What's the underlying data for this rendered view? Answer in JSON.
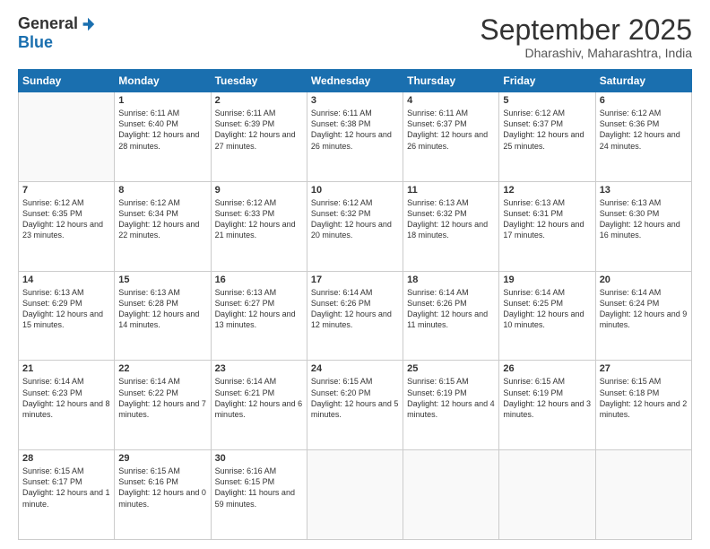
{
  "logo": {
    "general": "General",
    "blue": "Blue"
  },
  "title": "September 2025",
  "location": "Dharashiv, Maharashtra, India",
  "headers": [
    "Sunday",
    "Monday",
    "Tuesday",
    "Wednesday",
    "Thursday",
    "Friday",
    "Saturday"
  ],
  "weeks": [
    [
      {
        "day": "",
        "info": ""
      },
      {
        "day": "1",
        "info": "Sunrise: 6:11 AM\nSunset: 6:40 PM\nDaylight: 12 hours\nand 28 minutes."
      },
      {
        "day": "2",
        "info": "Sunrise: 6:11 AM\nSunset: 6:39 PM\nDaylight: 12 hours\nand 27 minutes."
      },
      {
        "day": "3",
        "info": "Sunrise: 6:11 AM\nSunset: 6:38 PM\nDaylight: 12 hours\nand 26 minutes."
      },
      {
        "day": "4",
        "info": "Sunrise: 6:11 AM\nSunset: 6:37 PM\nDaylight: 12 hours\nand 26 minutes."
      },
      {
        "day": "5",
        "info": "Sunrise: 6:12 AM\nSunset: 6:37 PM\nDaylight: 12 hours\nand 25 minutes."
      },
      {
        "day": "6",
        "info": "Sunrise: 6:12 AM\nSunset: 6:36 PM\nDaylight: 12 hours\nand 24 minutes."
      }
    ],
    [
      {
        "day": "7",
        "info": "Sunrise: 6:12 AM\nSunset: 6:35 PM\nDaylight: 12 hours\nand 23 minutes."
      },
      {
        "day": "8",
        "info": "Sunrise: 6:12 AM\nSunset: 6:34 PM\nDaylight: 12 hours\nand 22 minutes."
      },
      {
        "day": "9",
        "info": "Sunrise: 6:12 AM\nSunset: 6:33 PM\nDaylight: 12 hours\nand 21 minutes."
      },
      {
        "day": "10",
        "info": "Sunrise: 6:12 AM\nSunset: 6:32 PM\nDaylight: 12 hours\nand 20 minutes."
      },
      {
        "day": "11",
        "info": "Sunrise: 6:13 AM\nSunset: 6:32 PM\nDaylight: 12 hours\nand 18 minutes."
      },
      {
        "day": "12",
        "info": "Sunrise: 6:13 AM\nSunset: 6:31 PM\nDaylight: 12 hours\nand 17 minutes."
      },
      {
        "day": "13",
        "info": "Sunrise: 6:13 AM\nSunset: 6:30 PM\nDaylight: 12 hours\nand 16 minutes."
      }
    ],
    [
      {
        "day": "14",
        "info": "Sunrise: 6:13 AM\nSunset: 6:29 PM\nDaylight: 12 hours\nand 15 minutes."
      },
      {
        "day": "15",
        "info": "Sunrise: 6:13 AM\nSunset: 6:28 PM\nDaylight: 12 hours\nand 14 minutes."
      },
      {
        "day": "16",
        "info": "Sunrise: 6:13 AM\nSunset: 6:27 PM\nDaylight: 12 hours\nand 13 minutes."
      },
      {
        "day": "17",
        "info": "Sunrise: 6:14 AM\nSunset: 6:26 PM\nDaylight: 12 hours\nand 12 minutes."
      },
      {
        "day": "18",
        "info": "Sunrise: 6:14 AM\nSunset: 6:26 PM\nDaylight: 12 hours\nand 11 minutes."
      },
      {
        "day": "19",
        "info": "Sunrise: 6:14 AM\nSunset: 6:25 PM\nDaylight: 12 hours\nand 10 minutes."
      },
      {
        "day": "20",
        "info": "Sunrise: 6:14 AM\nSunset: 6:24 PM\nDaylight: 12 hours\nand 9 minutes."
      }
    ],
    [
      {
        "day": "21",
        "info": "Sunrise: 6:14 AM\nSunset: 6:23 PM\nDaylight: 12 hours\nand 8 minutes."
      },
      {
        "day": "22",
        "info": "Sunrise: 6:14 AM\nSunset: 6:22 PM\nDaylight: 12 hours\nand 7 minutes."
      },
      {
        "day": "23",
        "info": "Sunrise: 6:14 AM\nSunset: 6:21 PM\nDaylight: 12 hours\nand 6 minutes."
      },
      {
        "day": "24",
        "info": "Sunrise: 6:15 AM\nSunset: 6:20 PM\nDaylight: 12 hours\nand 5 minutes."
      },
      {
        "day": "25",
        "info": "Sunrise: 6:15 AM\nSunset: 6:19 PM\nDaylight: 12 hours\nand 4 minutes."
      },
      {
        "day": "26",
        "info": "Sunrise: 6:15 AM\nSunset: 6:19 PM\nDaylight: 12 hours\nand 3 minutes."
      },
      {
        "day": "27",
        "info": "Sunrise: 6:15 AM\nSunset: 6:18 PM\nDaylight: 12 hours\nand 2 minutes."
      }
    ],
    [
      {
        "day": "28",
        "info": "Sunrise: 6:15 AM\nSunset: 6:17 PM\nDaylight: 12 hours\nand 1 minute."
      },
      {
        "day": "29",
        "info": "Sunrise: 6:15 AM\nSunset: 6:16 PM\nDaylight: 12 hours\nand 0 minutes."
      },
      {
        "day": "30",
        "info": "Sunrise: 6:16 AM\nSunset: 6:15 PM\nDaylight: 11 hours\nand 59 minutes."
      },
      {
        "day": "",
        "info": ""
      },
      {
        "day": "",
        "info": ""
      },
      {
        "day": "",
        "info": ""
      },
      {
        "day": "",
        "info": ""
      }
    ]
  ]
}
